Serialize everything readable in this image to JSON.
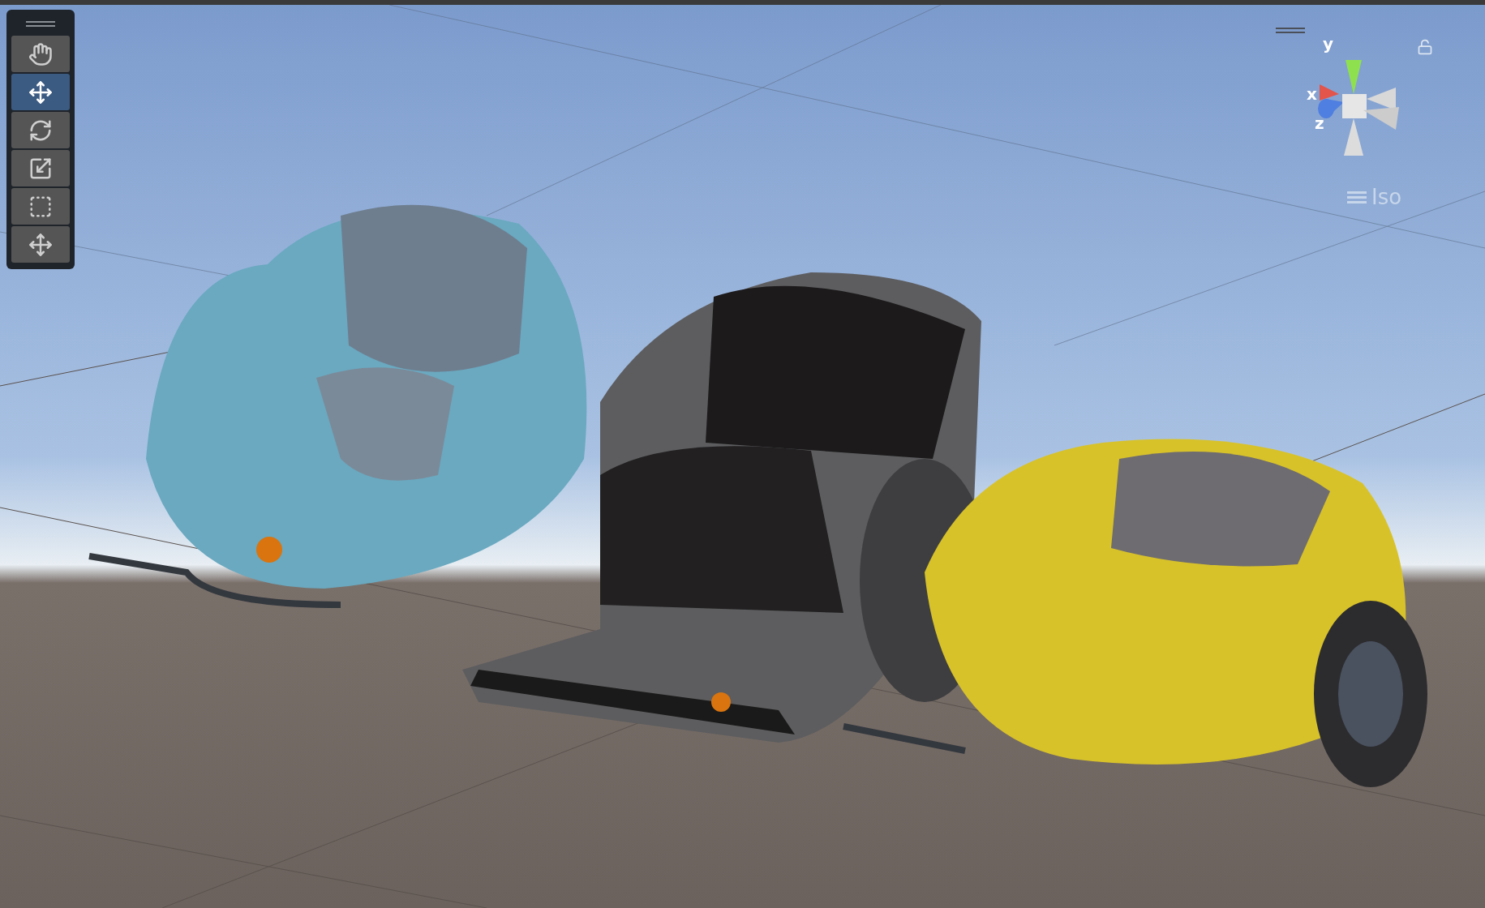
{
  "toolbar": {
    "tools": [
      {
        "kind": "hand",
        "selected": false
      },
      {
        "kind": "move",
        "selected": true
      },
      {
        "kind": "rotate",
        "selected": false
      },
      {
        "kind": "scale",
        "selected": false
      },
      {
        "kind": "rect",
        "selected": false
      },
      {
        "kind": "transform",
        "selected": false
      }
    ]
  },
  "gizmo": {
    "axes": [
      {
        "kind": "y",
        "label": "y"
      },
      {
        "kind": "x",
        "label": "x"
      },
      {
        "kind": "z",
        "label": "z"
      }
    ],
    "projection": "Iso",
    "locked": false
  }
}
